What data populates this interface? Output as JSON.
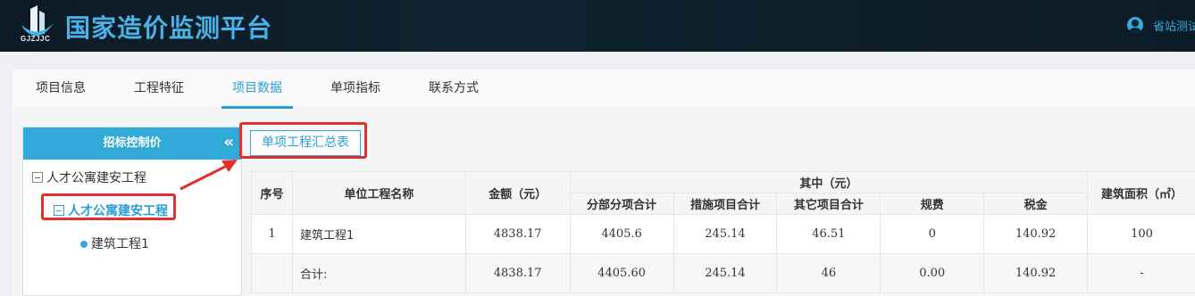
{
  "header": {
    "logo_text": "GJZJJC",
    "site_title": "国家造价监测平台",
    "user_name": "省站测试"
  },
  "tabs": [
    {
      "label": "项目信息"
    },
    {
      "label": "工程特征"
    },
    {
      "label": "项目数据",
      "active": true
    },
    {
      "label": "单项指标"
    },
    {
      "label": "联系方式"
    }
  ],
  "tree": {
    "header": "招标控制价",
    "collapse_glyph": "«",
    "nodes": [
      {
        "label": "人才公寓建安工程"
      },
      {
        "label": "人才公寓建安工程"
      },
      {
        "label": "建筑工程1"
      }
    ]
  },
  "summary_button": "单项工程汇总表",
  "table": {
    "headers": {
      "index": "序号",
      "name": "单位工程名称",
      "amount": "金额（元）",
      "of_which": "其中（元）",
      "sub_items": "分部分项合计",
      "measures": "措施项目合计",
      "other": "其它项目合计",
      "fees": "规费",
      "tax": "税金",
      "area": "建筑面积（㎡）"
    },
    "rows": [
      {
        "index": "1",
        "name": "建筑工程1",
        "amount": "4838.17",
        "sub_items": "4405.6",
        "measures": "245.14",
        "other": "46.51",
        "fees": "0",
        "tax": "140.92",
        "area": "100"
      }
    ],
    "total": {
      "index": "",
      "name": "合计:",
      "amount": "4838.17",
      "sub_items": "4405.60",
      "measures": "245.14",
      "other": "46",
      "fees": "0.00",
      "tax": "140.92",
      "area": "-"
    }
  },
  "colors": {
    "accent": "#2a9fd6",
    "header_bg": "#0f2330",
    "highlight": "#e0312a"
  }
}
